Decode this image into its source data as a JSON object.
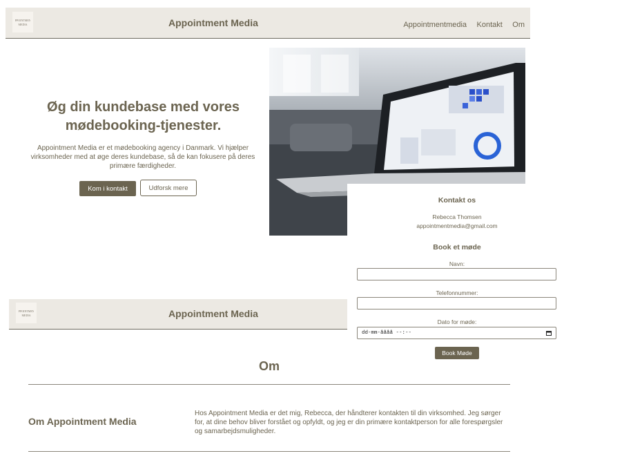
{
  "header": {
    "logo_text": "APPOINTMENT MEDIA",
    "brand": "Appointment Media",
    "nav": [
      "Appointmentmedia",
      "Kontakt",
      "Om"
    ]
  },
  "hero": {
    "title": "Øg din kundebase med vores mødebooking-tjenester.",
    "text": "Appointment Media er et mødebooking agency i Danmark. Vi hjælper virksomheder med at øge deres kundebase, så de kan fokusere på deres primære færdigheder.",
    "primary_button": "Kom i kontakt",
    "secondary_button": "Udforsk mere"
  },
  "contact": {
    "title": "Kontakt os",
    "name": "Rebecca Thomsen",
    "email": "appointmentmedia@gmail.com",
    "form_title": "Book et møde",
    "label_name": "Navn:",
    "label_phone": "Telefonnummer:",
    "label_date": "Dato for møde:",
    "date_placeholder": "dd-mm-åååå --:--",
    "submit": "Book Møde"
  },
  "header2": {
    "brand": "Appointment Media"
  },
  "about": {
    "title": "Om",
    "subtitle": "Om Appointment Media",
    "text": "Hos Appointment Media er det mig, Rebecca, der håndterer kontakten til din virksomhed. Jeg sørger for, at dine behov bliver forstået og opfyldt, og jeg er din primære kontaktperson for alle forespørgsler og samarbejdsmuligheder."
  },
  "colors": {
    "accent": "#6b6450",
    "header_bg": "#ece9e3"
  }
}
